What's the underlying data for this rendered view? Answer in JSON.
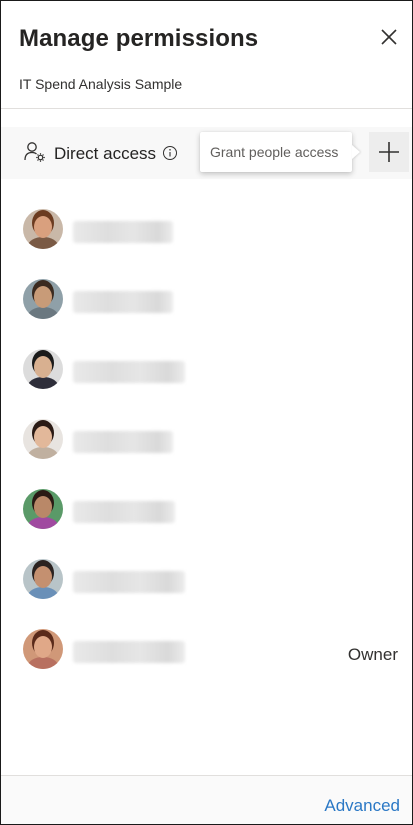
{
  "header": {
    "title": "Manage permissions",
    "subtitle": "IT Spend Analysis Sample",
    "close_icon": "close-icon"
  },
  "access": {
    "label": "Direct access",
    "icon": "people-settings-icon",
    "info_icon": "info-icon",
    "tooltip": "Grant people access",
    "add_icon": "plus-icon"
  },
  "people": [
    {
      "name": "",
      "role": "",
      "colors": {
        "skin": "#d9a07e",
        "hair": "#6b3b20",
        "bg": "#c9b8a8",
        "shirt": "#7a5a45"
      }
    },
    {
      "name": "",
      "role": "",
      "colors": {
        "skin": "#c89b78",
        "hair": "#3a2a20",
        "bg": "#8fa0a8",
        "shirt": "#6b7880"
      }
    },
    {
      "name": "",
      "role": "",
      "colors": {
        "skin": "#d8b090",
        "hair": "#1a1a1a",
        "bg": "#dcdcdc",
        "shirt": "#2e2e3a"
      }
    },
    {
      "name": "",
      "role": "",
      "colors": {
        "skin": "#e2b89a",
        "hair": "#2a1a14",
        "bg": "#e8e4e0",
        "shirt": "#c0b0a0"
      }
    },
    {
      "name": "",
      "role": "",
      "colors": {
        "skin": "#b98868",
        "hair": "#2a1a14",
        "bg": "#5a9a68",
        "shirt": "#a04aa0"
      }
    },
    {
      "name": "",
      "role": "",
      "colors": {
        "skin": "#c49070",
        "hair": "#2a2220",
        "bg": "#b8c4c8",
        "shirt": "#6a90b8"
      }
    },
    {
      "name": "",
      "role": "Owner",
      "colors": {
        "skin": "#e0a888",
        "hair": "#5a2a1a",
        "bg": "#d09878",
        "shirt": "#b87060"
      }
    }
  ],
  "footer": {
    "advanced_label": "Advanced",
    "link_color": "#2b78c5"
  }
}
